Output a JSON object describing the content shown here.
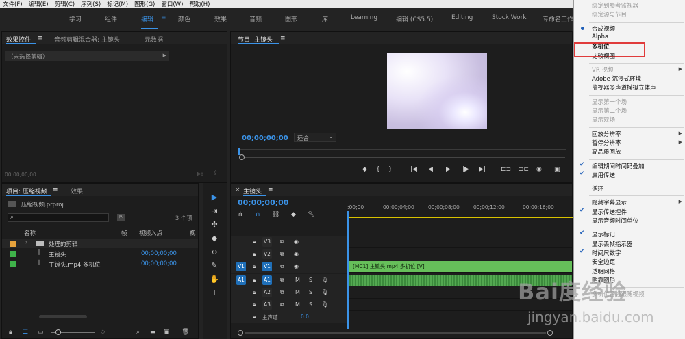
{
  "menubar": [
    "文件(F)",
    "编辑(E)",
    "剪辑(C)",
    "序列(S)",
    "标记(M)",
    "图形(G)",
    "窗口(W)",
    "帮助(H)"
  ],
  "workspaces": {
    "items": [
      "学习",
      "组件",
      "编辑",
      "颜色",
      "效果",
      "音频",
      "图形",
      "库",
      "Learning",
      "编辑 (CS5.5)",
      "Editing",
      "Stock Work",
      "专命名工作区"
    ],
    "active": "编辑",
    "menu_glyph": "≡"
  },
  "source_panel": {
    "tabs": [
      "效果控件",
      "音频剪辑混合器: 主镜头",
      "元数据"
    ],
    "tab_menu": "≡",
    "clip_selector": "（未选择剪辑）",
    "timecode": "00;00;00;00"
  },
  "program_monitor": {
    "title": "节目: 主镜头",
    "tab_menu": "≡",
    "timecode": "00;00;00;00",
    "fit": "适合",
    "transport": [
      "◆",
      "{",
      "}",
      "|◀",
      "◀|",
      "▶",
      "|▶",
      "▶|",
      "⊏⊐",
      "⊐⊏",
      "◉",
      "▣"
    ]
  },
  "project_panel": {
    "title": "项目: 压缩视频",
    "tab_menu": "≡",
    "effects_tab": "效果",
    "file": "压缩视频.prproj",
    "item_count": "3 个项",
    "columns": [
      "名称",
      "帧",
      "视频入点",
      "视"
    ],
    "rows": [
      {
        "name": "处理的剪辑",
        "color": "#e6a23c",
        "in_point": "",
        "kind": "folder"
      },
      {
        "name": "主镜头",
        "color": "#3fb24a",
        "in_point": "00;00;00;00",
        "kind": "sequence"
      },
      {
        "name": "主镜头.mp4 多机位",
        "color": "#3fb24a",
        "in_point": "00;00;00;00",
        "kind": "sequence"
      }
    ]
  },
  "tools": [
    "▶",
    "⇥",
    "✣",
    "◆",
    "↔",
    "✎",
    "✋",
    "T"
  ],
  "timeline": {
    "tab_close": "×",
    "title": "主镜头",
    "tab_menu": "≡",
    "timecode": "00;00;00;00",
    "ruler": [
      ":00;00",
      "00;00;04;00",
      "00;00;08;00",
      "00;00;12;00",
      "00;00;16;00"
    ],
    "tracks": [
      {
        "id": "V3",
        "type": "video",
        "clip": ""
      },
      {
        "id": "V2",
        "type": "video",
        "clip": ""
      },
      {
        "id": "V1",
        "type": "video",
        "clip": "[MC1] 主镜头.mp4 多机位 [V]",
        "src": "V1"
      },
      {
        "id": "A1",
        "type": "audio",
        "clip": "waveform",
        "src": "A1"
      },
      {
        "id": "A2",
        "type": "audio",
        "clip": ""
      },
      {
        "id": "A3",
        "type": "audio",
        "clip": ""
      }
    ],
    "master": {
      "label": "主声道",
      "value": "0.0"
    }
  },
  "context_menu": {
    "items": [
      {
        "label": "绑定到参考监视器",
        "state": "disabled"
      },
      {
        "label": "绑定源与节目",
        "state": "disabled"
      },
      {
        "label": "sep"
      },
      {
        "label": "合成视频",
        "state": "radio"
      },
      {
        "label": "Alpha",
        "state": "normal"
      },
      {
        "label": "多机位",
        "state": "highlight"
      },
      {
        "label": "比较视图",
        "state": "normal"
      },
      {
        "label": "sep"
      },
      {
        "label": "VR 视频",
        "state": "disabled",
        "submenu": true
      },
      {
        "label": "Adobe 沉浸式环境",
        "state": "normal"
      },
      {
        "label": "监视器多声道模拟立体声",
        "state": "normal"
      },
      {
        "label": "sep"
      },
      {
        "label": "显示第一个场",
        "state": "disabled"
      },
      {
        "label": "显示第二个场",
        "state": "disabled"
      },
      {
        "label": "显示双场",
        "state": "disabled"
      },
      {
        "label": "sep"
      },
      {
        "label": "回放分辨率",
        "state": "normal",
        "submenu": true
      },
      {
        "label": "暂停分辨率",
        "state": "normal",
        "submenu": true
      },
      {
        "label": "高品质回放",
        "state": "normal"
      },
      {
        "label": "sep"
      },
      {
        "label": "编辑期间时间码叠加",
        "state": "checked"
      },
      {
        "label": "启用传送",
        "state": "checked"
      },
      {
        "label": "sep"
      },
      {
        "label": "循环",
        "state": "normal"
      },
      {
        "label": "sep"
      },
      {
        "label": "隐藏字幕显示",
        "state": "normal",
        "submenu": true
      },
      {
        "label": "显示传送控件",
        "state": "checked"
      },
      {
        "label": "显示音频时间单位",
        "state": "normal"
      },
      {
        "label": "sep"
      },
      {
        "label": "显示标记",
        "state": "checked"
      },
      {
        "label": "显示丢帧指示器",
        "state": "normal"
      },
      {
        "label": "时间尺数字",
        "state": "checked"
      },
      {
        "label": "安全边距",
        "state": "normal"
      },
      {
        "label": "透明网格",
        "state": "normal"
      },
      {
        "label": "贴靠图形",
        "state": "normal"
      },
      {
        "label": "sep"
      },
      {
        "label": "多机位音频跟随视频",
        "state": "disabled"
      }
    ]
  },
  "watermark": {
    "main": "Bai度经验",
    "sub": "jingyan.baidu.com"
  }
}
